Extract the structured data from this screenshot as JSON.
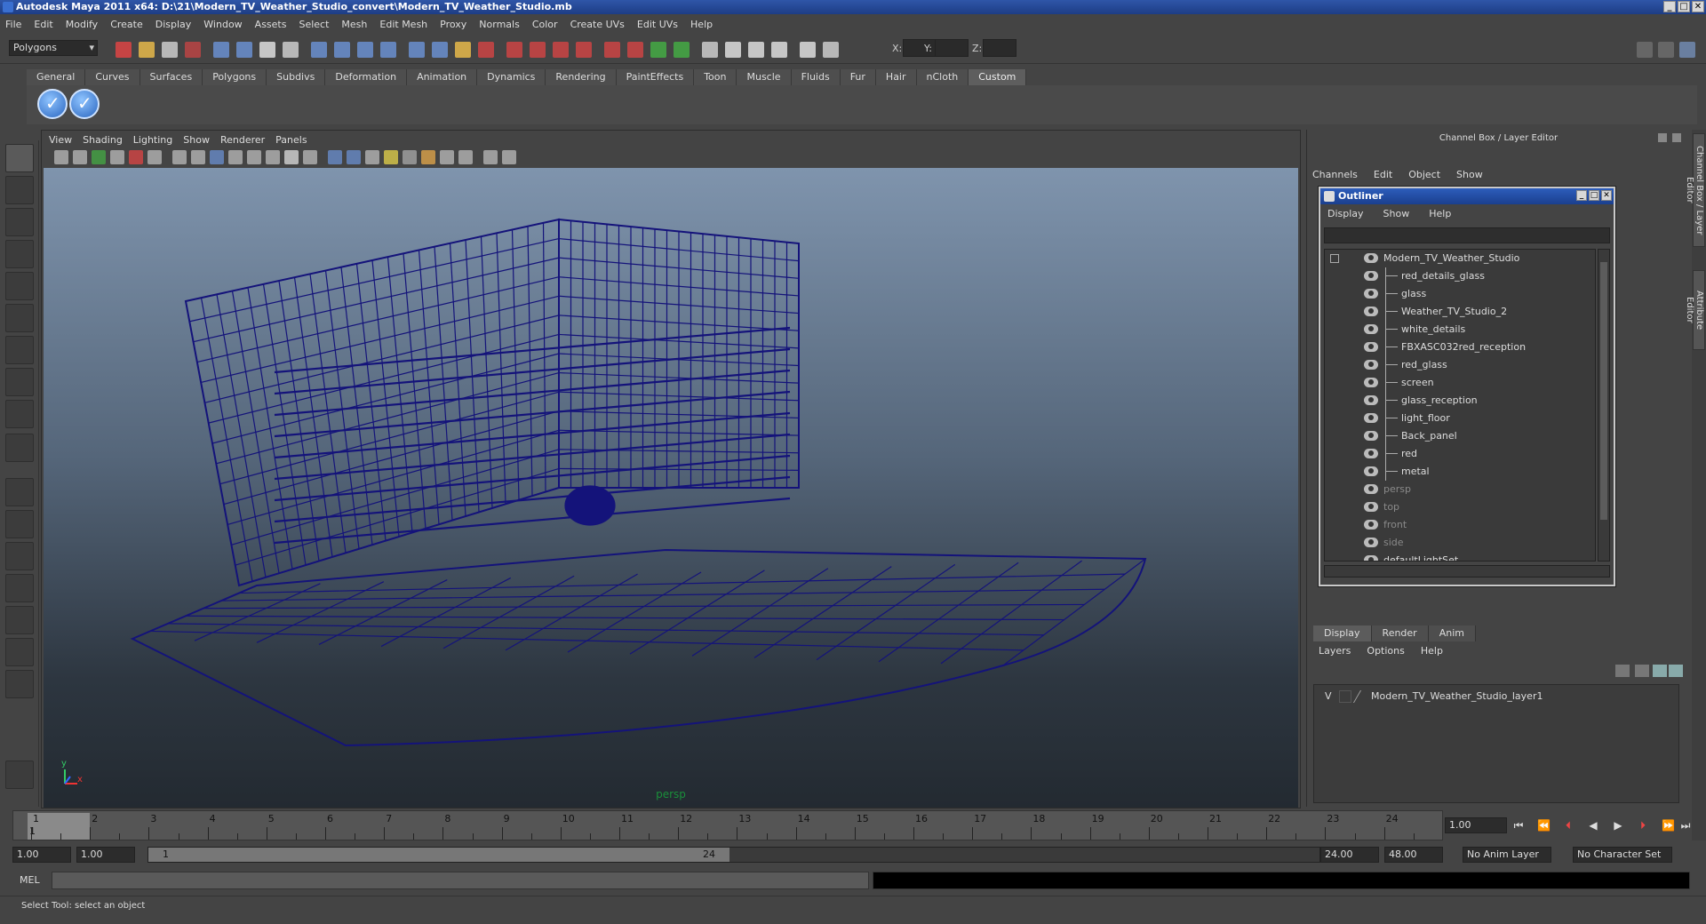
{
  "window": {
    "title": "Autodesk Maya 2011 x64: D:\\21\\Modern_TV_Weather_Studio_convert\\Modern_TV_Weather_Studio.mb"
  },
  "menubar": [
    "File",
    "Edit",
    "Modify",
    "Create",
    "Display",
    "Window",
    "Assets",
    "Select",
    "Mesh",
    "Edit Mesh",
    "Proxy",
    "Normals",
    "Color",
    "Create UVs",
    "Edit UVs",
    "Help"
  ],
  "statusline": {
    "mode": "Polygons",
    "x_label": "X:",
    "y_label": "Y:",
    "z_label": "Z:"
  },
  "shelf": {
    "tabs": [
      "General",
      "Curves",
      "Surfaces",
      "Polygons",
      "Subdivs",
      "Deformation",
      "Animation",
      "Dynamics",
      "Rendering",
      "PaintEffects",
      "Toon",
      "Muscle",
      "Fluids",
      "Fur",
      "Hair",
      "nCloth",
      "Custom"
    ],
    "active": "Custom"
  },
  "viewport": {
    "menu": [
      "View",
      "Shading",
      "Lighting",
      "Show",
      "Renderer",
      "Panels"
    ],
    "camera": "persp",
    "axis_y": "y",
    "axis_x": "x"
  },
  "channelbox": {
    "title": "Channel Box / Layer Editor",
    "menu": [
      "Channels",
      "Edit",
      "Object",
      "Show"
    ]
  },
  "side_tabs": [
    "Channel Box / Layer Editor",
    "Attribute Editor"
  ],
  "outliner": {
    "title": "Outliner",
    "menu": [
      "Display",
      "Show",
      "Help"
    ],
    "root": "Modern_TV_Weather_Studio",
    "children": [
      "red_details_glass",
      "glass",
      "Weather_TV_Studio_2",
      "white_details",
      "FBXASC032red_reception",
      "red_glass",
      "screen",
      "glass_reception",
      "light_floor",
      "Back_panel",
      "red",
      "metal"
    ],
    "cameras": [
      "persp",
      "top",
      "front",
      "side"
    ],
    "sets": [
      "defaultLightSet"
    ]
  },
  "layers": {
    "tabs": [
      "Display",
      "Render",
      "Anim"
    ],
    "active": "Display",
    "menu": [
      "Layers",
      "Options",
      "Help"
    ],
    "row": {
      "visible": "V",
      "name": "Modern_TV_Weather_Studio_layer1"
    }
  },
  "timeline": {
    "ticks": [
      "1",
      "2",
      "3",
      "4",
      "5",
      "6",
      "7",
      "8",
      "9",
      "10",
      "11",
      "12",
      "13",
      "14",
      "15",
      "16",
      "17",
      "18",
      "19",
      "20",
      "21",
      "22",
      "23",
      "24"
    ],
    "current": "1",
    "current_field": "1.00"
  },
  "range": {
    "start": "1.00",
    "start2": "1.00",
    "slider_start": "1",
    "slider_end": "24",
    "end": "24.00",
    "end2": "48.00",
    "anim_layer": "No Anim Layer",
    "char_set": "No Character Set"
  },
  "cmd": {
    "label": "MEL"
  },
  "help": {
    "text": "Select Tool: select an object"
  }
}
